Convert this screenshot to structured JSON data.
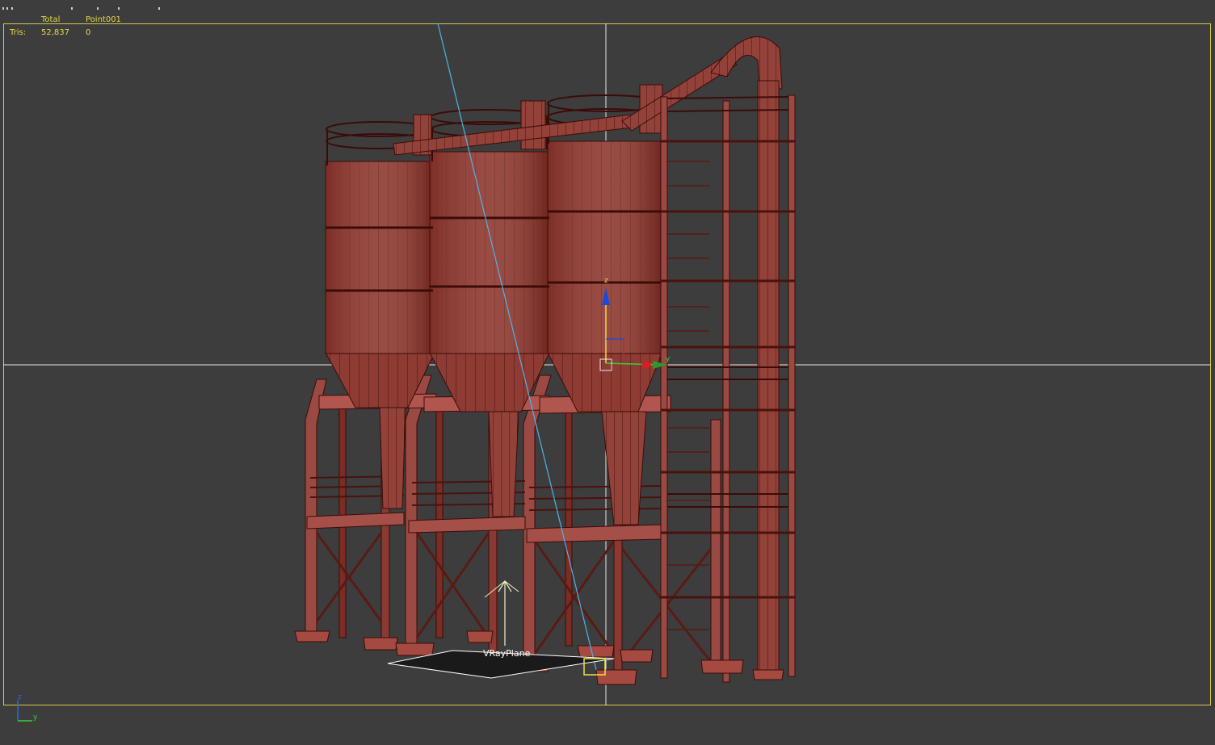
{
  "viewport": {
    "stats": {
      "col_total": "Total",
      "col_selected": "Point001",
      "row_label": "Tris:",
      "total_value": "52,837",
      "selected_value": "0"
    },
    "object_label": "VRayPlane",
    "gizmo": {
      "z_label": "z",
      "y_label": "y"
    },
    "axis_tripod": {
      "z_label": "z",
      "y_label": "y"
    }
  },
  "colors": {
    "background": "#3d3d3d",
    "frame": "#d8c84a",
    "stats_text": "#e3d84a",
    "model_fill": "#8a3a32",
    "model_line": "#3a0c08",
    "crosshair": "#e8e8e8",
    "light_ray": "#4fb3e8"
  }
}
